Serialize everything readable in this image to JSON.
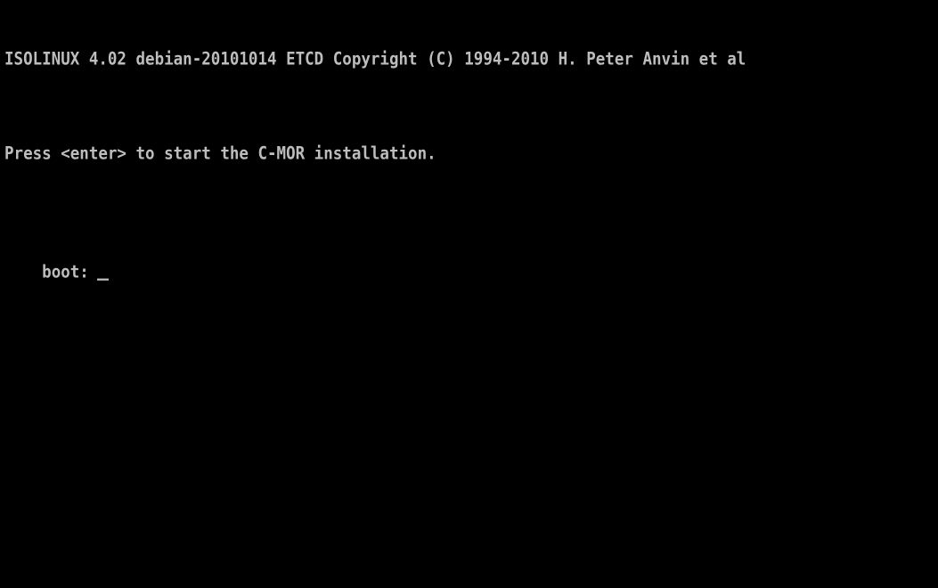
{
  "console": {
    "banner": "ISOLINUX 4.02 debian-20101014 ETCD Copyright (C) 1994-2010 H. Peter Anvin et al",
    "message": "Press <enter> to start the C-MOR installation.",
    "prompt": "boot:",
    "input_value": "",
    "text_color": "#bdbdbd",
    "background_color": "#000000"
  }
}
